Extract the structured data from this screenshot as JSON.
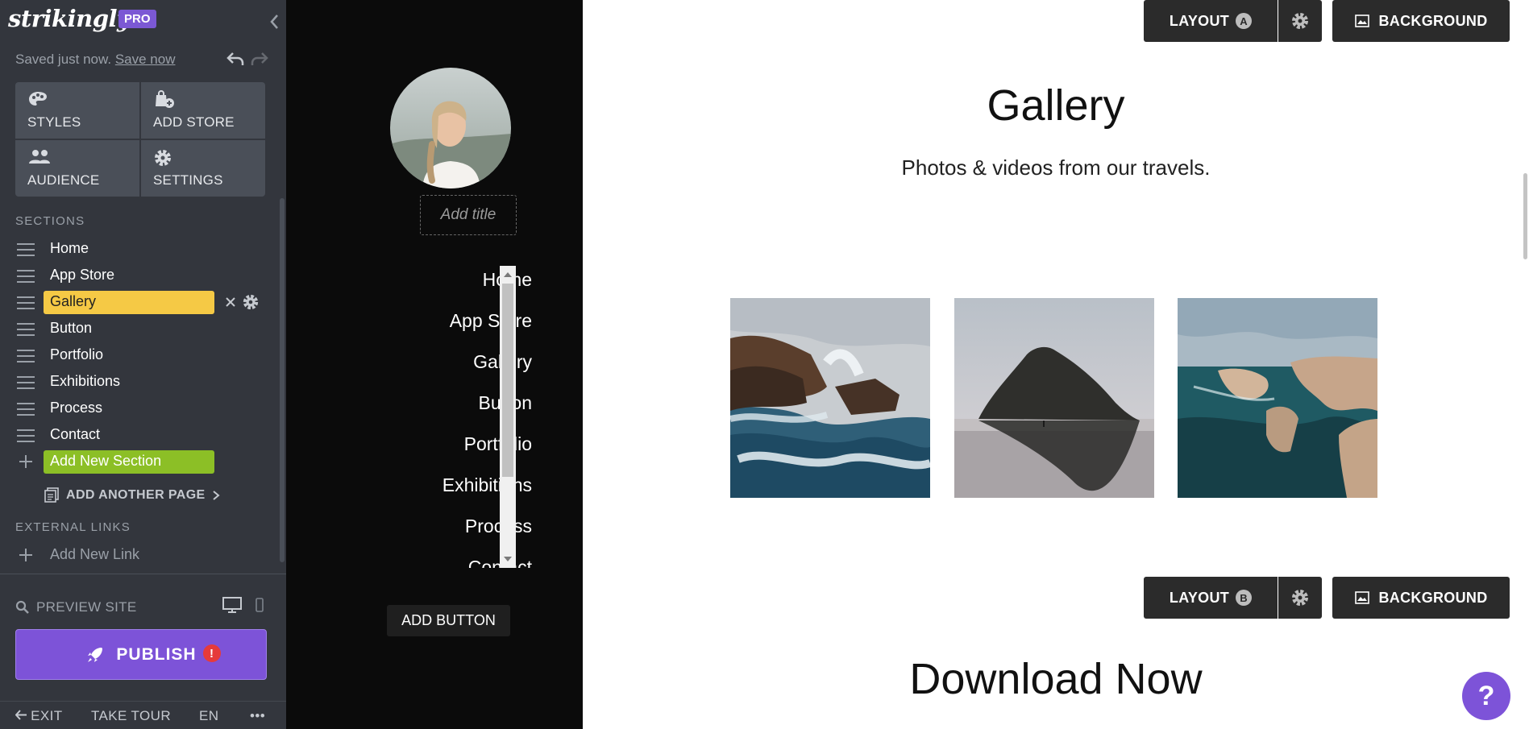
{
  "sidebar": {
    "logo_text": "strikingly",
    "pro_badge": "PRO",
    "saved_text": "Saved just now.",
    "save_now_link": "Save now",
    "tools": [
      {
        "label": "STYLES",
        "icon": "palette-icon"
      },
      {
        "label": "ADD STORE",
        "icon": "store-icon"
      },
      {
        "label": "AUDIENCE",
        "icon": "people-icon"
      },
      {
        "label": "SETTINGS",
        "icon": "gear-icon"
      }
    ],
    "sections_heading": "SECTIONS",
    "sections": [
      {
        "label": "Home"
      },
      {
        "label": "App Store"
      },
      {
        "label": "Gallery",
        "active": true
      },
      {
        "label": "Button"
      },
      {
        "label": "Portfolio"
      },
      {
        "label": "Exhibitions"
      },
      {
        "label": "Process"
      },
      {
        "label": "Contact"
      }
    ],
    "add_section_label": "Add New Section",
    "add_page_label": "ADD ANOTHER PAGE",
    "external_links_heading": "EXTERNAL LINKS",
    "add_link_label": "Add New Link",
    "preview_label": "PREVIEW SITE",
    "publish_label": "PUBLISH",
    "publish_alert": "!",
    "bottom": {
      "exit": "EXIT",
      "tour": "TAKE TOUR",
      "lang": "EN",
      "more": "•••"
    }
  },
  "nav_preview": {
    "add_title_placeholder": "Add title",
    "nav_items": [
      "Home",
      "App Store",
      "Gallery",
      "Button",
      "Portfolio",
      "Exhibitions",
      "Process",
      "Contact"
    ],
    "add_button_label": "ADD BUTTON"
  },
  "main": {
    "toolbar_top": {
      "layout_label": "LAYOUT",
      "layout_variant": "A",
      "background_label": "BACKGROUND"
    },
    "gallery_title": "Gallery",
    "gallery_subtitle": "Photos & videos from our travels.",
    "photos": [
      "ocean-cliffs-photo",
      "rock-island-photo",
      "sea-arches-photo"
    ],
    "toolbar_bottom": {
      "layout_label": "LAYOUT",
      "layout_variant": "B",
      "background_label": "BACKGROUND"
    },
    "download_title": "Download Now",
    "help_label": "?"
  },
  "colors": {
    "sidebar_bg": "#33363d",
    "active_section": "#f5c945",
    "add_section": "#8cbf26",
    "publish": "#7d53d8",
    "nav_bg": "#0b0b0b"
  }
}
